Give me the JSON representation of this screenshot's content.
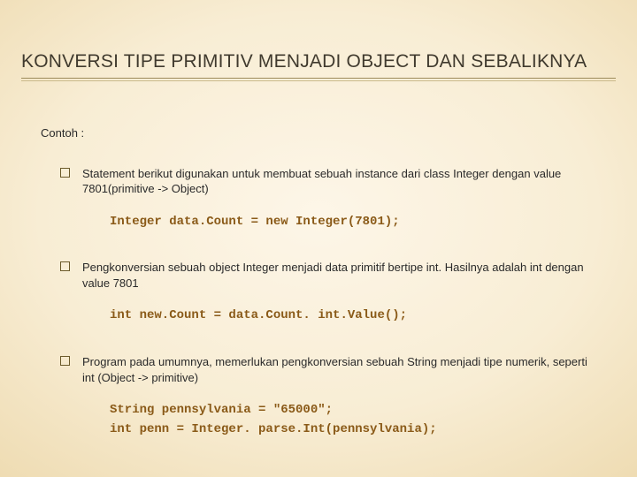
{
  "title": "KONVERSI TIPE PRIMITIV MENJADI OBJECT DAN SEBALIKNYA",
  "contoh_label": "Contoh :",
  "items": [
    {
      "text": "Statement berikut digunakan untuk membuat sebuah instance dari class Integer dengan value 7801(primitive -> Object)",
      "code": [
        "Integer data.Count = new Integer(7801);"
      ]
    },
    {
      "text": "Pengkonversian sebuah object Integer menjadi data primitif bertipe int. Hasilnya adalah int dengan value 7801",
      "code": [
        "int new.Count = data.Count. int.Value();"
      ]
    },
    {
      "text": "Program pada umumnya, memerlukan pengkonversian sebuah String menjadi tipe numerik, seperti int (Object -> primitive)",
      "code": [
        "String pennsylvania = \"65000\";",
        "int penn = Integer. parse.Int(pennsylvania);"
      ]
    }
  ]
}
